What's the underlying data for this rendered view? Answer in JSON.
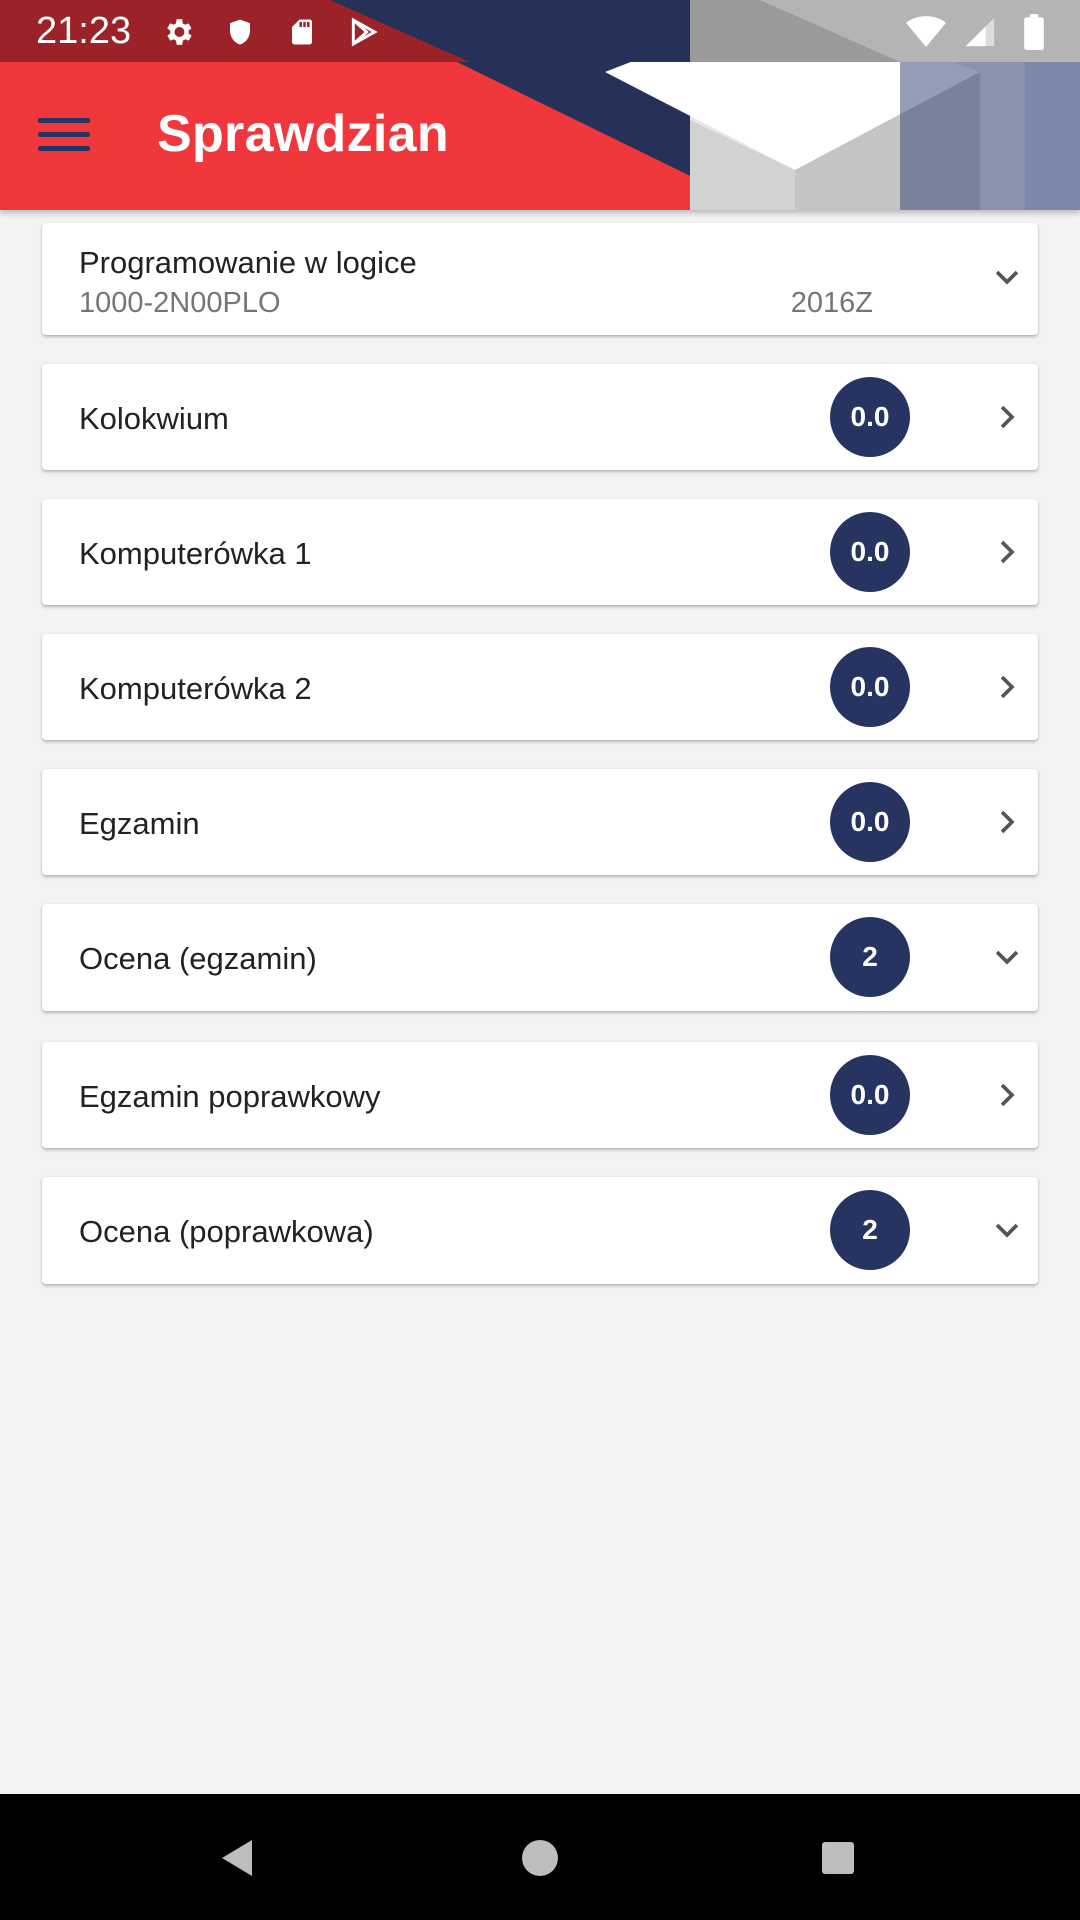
{
  "status_bar": {
    "time": "21:23",
    "left_icons": [
      "gear-icon",
      "shield-icon",
      "sd-card-icon",
      "play-store-icon"
    ],
    "right_icons": [
      "wifi-icon",
      "signal-icon",
      "battery-icon"
    ]
  },
  "app_bar": {
    "title": "Sprawdzian",
    "menu_icon": "hamburger-menu-icon",
    "colors": {
      "primary": "#f0383c",
      "accent": "#273461"
    }
  },
  "course": {
    "name": "Programowanie w logice",
    "code": "1000-2N00PLO",
    "semester": "2016Z",
    "chevron": "chevron-down-icon"
  },
  "tests": [
    {
      "label": "Kolokwium",
      "score": "0.0",
      "chevron": "chevron-right-icon"
    },
    {
      "label": "Komputerówka 1",
      "score": "0.0",
      "chevron": "chevron-right-icon"
    },
    {
      "label": "Komputerówka 2",
      "score": "0.0",
      "chevron": "chevron-right-icon"
    },
    {
      "label": "Egzamin",
      "score": "0.0",
      "chevron": "chevron-right-icon"
    },
    {
      "label": "Ocena (egzamin)",
      "score": "2",
      "chevron": "chevron-down-icon"
    },
    {
      "label": "Egzamin poprawkowy",
      "score": "0.0",
      "chevron": "chevron-right-icon"
    },
    {
      "label": "Ocena (poprawkowa)",
      "score": "2",
      "chevron": "chevron-down-icon"
    }
  ],
  "nav_bar": [
    "back-icon",
    "home-icon",
    "recents-icon"
  ]
}
